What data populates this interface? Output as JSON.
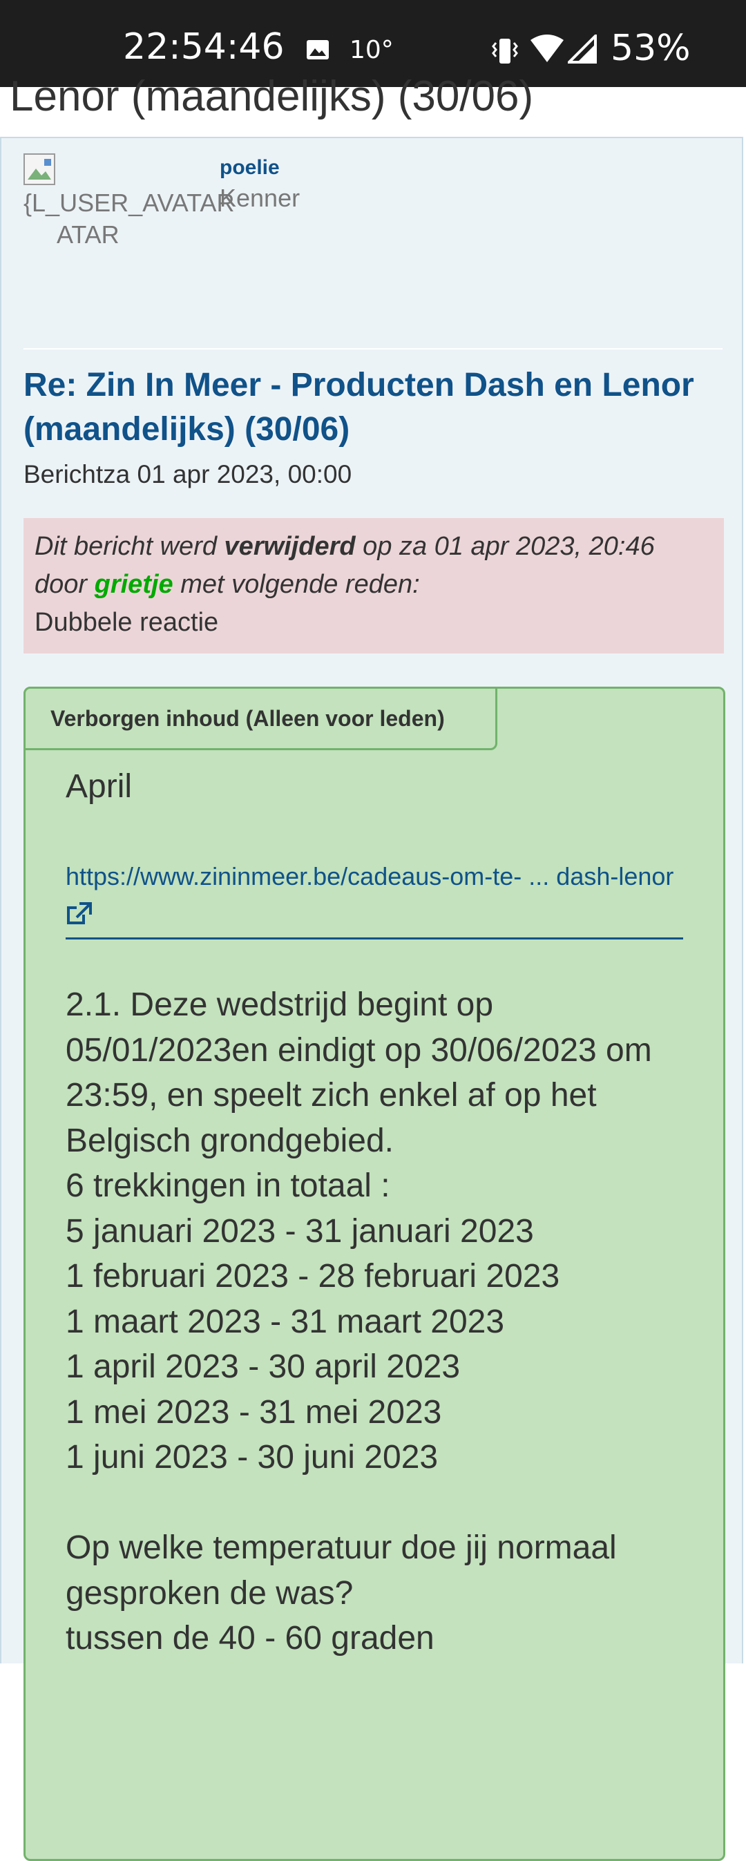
{
  "status_bar": {
    "time": "22:54:46",
    "temperature": "10°",
    "battery": "53%",
    "icons": [
      "image-icon",
      "vibrate-icon",
      "wifi-icon",
      "signal-icon"
    ]
  },
  "page": {
    "top_title": "Lenor (maandelijks) (30/06)"
  },
  "post": {
    "avatar_alt": "{L_USER_AVATAR",
    "avatar_alt_line2": "ATAR",
    "username": "poelie",
    "rank": "Kenner",
    "title": "Re: Zin In Meer - Producten Dash en Lenor (maandelijks) (30/06)",
    "meta": "Berichtza 01 apr 2023, 00:00",
    "deleted_notice": {
      "part1": "Dit bericht werd ",
      "verb": "verwijderd",
      "part2": " op za 01 apr 2023, 20:46 door ",
      "moderator": "grietje",
      "part3": " met volgende reden:",
      "reason": "Dubbele reactie"
    },
    "hidden_content": {
      "tab_label": "Verborgen inhoud (Alleen voor leden)",
      "month": "April",
      "link_text": "https://www.zininmeer.be/cadeaus-om-te- ... dash-lenor",
      "body": "2.1. Deze wedstrijd begint op 05/01/2023en eindigt op 30/06/2023 om 23:59, en speelt zich enkel af op het Belgisch grondgebied.\n6 trekkingen in totaal :\n5 januari 2023 - 31 januari 2023\n1 februari 2023 - 28 februari 2023\n1 maart 2023 - 31 maart 2023\n1 april 2023 - 30 april 2023\n1 mei 2023 - 31 mei 2023\n1 juni 2023 - 30 juni 2023\n\nOp welke temperatuur doe jij normaal gesproken de was?\ntussen de 40 - 60 graden"
    }
  },
  "colors": {
    "link_blue": "#105289",
    "panel_bg": "#ecf3f7",
    "deleted_bg": "#ecd5d8",
    "hidden_bg": "#c3e2bd",
    "hidden_border": "#72b26c",
    "moderator_green": "#00aa00"
  }
}
